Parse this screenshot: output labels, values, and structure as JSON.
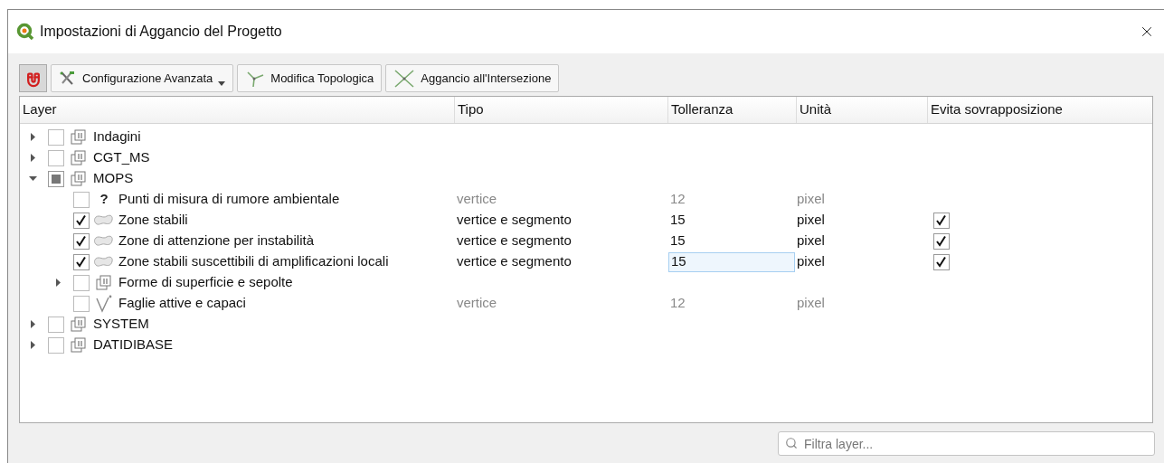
{
  "window": {
    "title": "Impostazioni di Aggancio del Progetto"
  },
  "toolbar": {
    "snapping_on": true,
    "buttons": [
      {
        "kind": "tools",
        "label": "Configurazione Avanzata",
        "dropdown": true
      },
      {
        "kind": "topology",
        "label": "Modifica Topologica",
        "dropdown": false
      },
      {
        "kind": "intersection",
        "label": "Aggancio all'Intersezione",
        "dropdown": false
      }
    ]
  },
  "table": {
    "columns": [
      "Layer",
      "Tipo",
      "Tolleranza",
      "Unità",
      "Evita sovrapposizione"
    ],
    "rows": [
      {
        "kind": "group",
        "name": "Indagini",
        "checked": false,
        "partial": false,
        "expanded": false
      },
      {
        "kind": "group",
        "name": "CGT_MS",
        "checked": false,
        "partial": false,
        "expanded": false
      },
      {
        "kind": "group",
        "name": "MOPS",
        "checked": false,
        "partial": true,
        "expanded": true,
        "children": [
          {
            "kind": "point",
            "glyph": "?",
            "name": "Punti di misura di rumore ambientale",
            "checked": false,
            "partial": false,
            "type": "vertice",
            "tolerance": "12",
            "unit": "pixel",
            "tolerance_selected": false
          },
          {
            "kind": "polygon",
            "name": "Zone stabili",
            "checked": true,
            "partial": false,
            "type": "vertice e segmento",
            "tolerance": "15",
            "unit": "pixel",
            "avoid_overlap": true,
            "tolerance_selected": false
          },
          {
            "kind": "polygon",
            "name": "Zone di attenzione per instabilità",
            "checked": true,
            "partial": false,
            "type": "vertice e segmento",
            "tolerance": "15",
            "unit": "pixel",
            "avoid_overlap": true,
            "tolerance_selected": false
          },
          {
            "kind": "polygon",
            "name": "Zone stabili suscettibili di amplificazioni locali",
            "checked": true,
            "partial": false,
            "type": "vertice e segmento",
            "tolerance": "15",
            "unit": "pixel",
            "avoid_overlap": true,
            "tolerance_selected": true
          },
          {
            "kind": "group",
            "name": "Forme di superficie e sepolte",
            "checked": false,
            "partial": false,
            "expanded": false
          },
          {
            "kind": "line",
            "name": "Faglie attive e capaci",
            "checked": false,
            "partial": false,
            "type": "vertice",
            "tolerance": "12",
            "unit": "pixel",
            "tolerance_selected": false
          }
        ]
      },
      {
        "kind": "group",
        "name": "SYSTEM",
        "checked": false,
        "partial": false,
        "expanded": false
      },
      {
        "kind": "group",
        "name": "DATIDIBASE",
        "checked": false,
        "partial": false,
        "expanded": false
      }
    ]
  },
  "filter": {
    "placeholder": "Filtra layer..."
  }
}
